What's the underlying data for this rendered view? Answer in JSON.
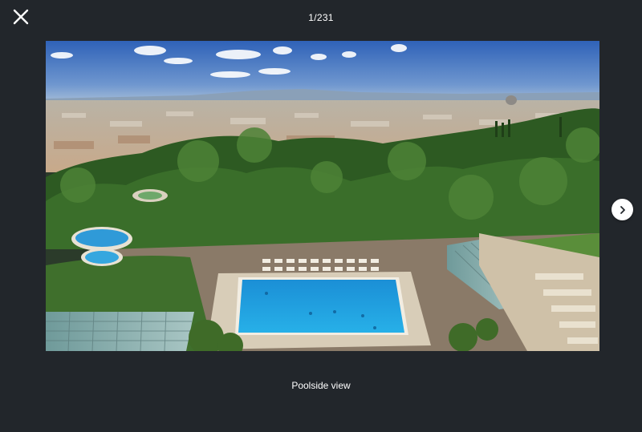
{
  "viewer": {
    "counter": "1/231",
    "caption": "Poolside view"
  },
  "controls": {
    "close_icon": "close-icon",
    "next_icon": "chevron-right-icon"
  },
  "colors": {
    "background": "#22262b",
    "text": "#ffffff",
    "next_button_bg": "#ffffff"
  }
}
